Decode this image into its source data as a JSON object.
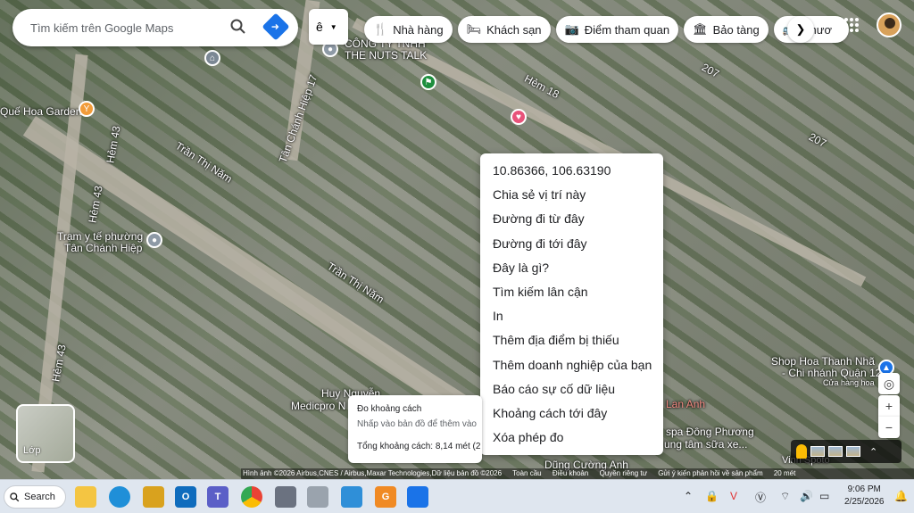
{
  "search": {
    "placeholder": "Tìm kiếm trên Google Maps"
  },
  "ime": {
    "label": "ê"
  },
  "chips": [
    {
      "label": "Nhà hàng",
      "icon": "fork-knife-icon"
    },
    {
      "label": "Khách sạn",
      "icon": "bed-icon"
    },
    {
      "label": "Điểm tham quan",
      "icon": "camera-icon"
    },
    {
      "label": "Bảo tàng",
      "icon": "museum-icon"
    },
    {
      "label": "Phươ",
      "icon": "bus-icon"
    }
  ],
  "map_labels": {
    "cong_ty": "CÔNG TY TNHH",
    "nuts_talk": "THE NUTS TALK",
    "hem18": "Hẻm 18",
    "r207a": "207",
    "r207b": "207",
    "que_hoa": "Quế Hoa Garden",
    "hem43a": "Hẻm 43",
    "hem43b": "Hẻm 43",
    "hem43c": "Hẻm 43",
    "tan_chanh_hiep17": "Tân Chánh Hiệp 17",
    "tran_thi_nam1": "Trần Thị Năm",
    "tran_thi_nam2": "Trần Thị Năm",
    "tram_yte1": "Trạm y tế phường",
    "tram_yte2": "Tân Chánh Hiệp",
    "shop_hoa1": "Shop Hoa Thanh Nhã",
    "shop_hoa2": "- Chi nhánh Quận 12",
    "cua_hang": "Cửa hàng hoa",
    "lan_anh": "Lan Anh",
    "spa1": "spa Đông Phương",
    "spa2": "ung tâm sữa xe...",
    "huy_nguyen1": "Huy Nguyễn",
    "huy_nguyen2": "Medicpro N",
    "dung_cuong": "Dũng Cường Anh",
    "vinh": "Vinh Spoto"
  },
  "context_menu": [
    "10.86366, 106.63190",
    "Chia sẻ vị trí này",
    "Đường đi từ đây",
    "Đường đi tới đây",
    "Đây là gì?",
    "Tìm kiếm lân cận",
    "In",
    "Thêm địa điểm bị thiếu",
    "Thêm doanh nghiệp của bạn",
    "Báo cáo sự cố dữ liệu",
    "Khoảng cách tới đây",
    "Xóa phép đo"
  ],
  "measure": {
    "title": "Đo khoảng cách",
    "subtitle": "Nhấp vào bản đồ để thêm vào",
    "total": "Tổng khoảng cách: 8,14 mét (2"
  },
  "layers": {
    "label": "Lớp"
  },
  "attribution": {
    "imagery": "Hình ảnh ©2026 Airbus,CNES / Airbus,Maxar Technologies,Dữ liệu bản đồ ©2026",
    "global": "Toàn cầu",
    "terms": "Điều khoản",
    "privacy": "Quyền riêng tư",
    "feedback": "Gửi ý kiến phản hồi về sản phẩm",
    "scale": "20 mét"
  },
  "taskbar": {
    "search_label": "Search",
    "time": "9:06 PM",
    "date": "2/25/2026"
  },
  "colors": {
    "accent": "#1a73e8",
    "menu_bg": "#ffffff"
  }
}
